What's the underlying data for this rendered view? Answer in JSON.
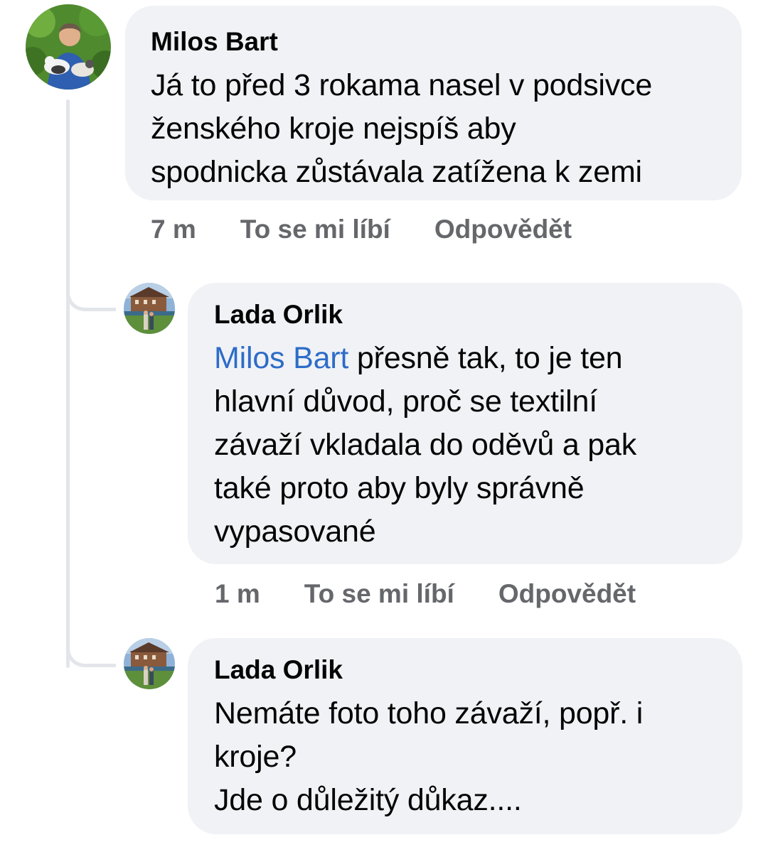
{
  "comments": [
    {
      "author": "Milos Bart",
      "lines": [
        "Já to před 3 rokama nasel v podsivce",
        "ženského kroje nejspíš aby",
        "spodnicka zůstávala zatížena k zemi"
      ],
      "time": "7 m",
      "like_label": "To se mi líbí",
      "reply_label": "Odpovědět"
    },
    {
      "author": "Lada Orlik",
      "mention": "Milos Bart",
      "first_line_rest": " přesně tak, to je ten",
      "lines": [
        "hlavní důvod, proč se textilní",
        "závaží vkladala do oděvů a pak",
        "také proto aby byly správně",
        "vypasované"
      ],
      "time": "1 m",
      "like_label": "To se mi líbí",
      "reply_label": "Odpovědět"
    },
    {
      "author": "Lada Orlik",
      "lines": [
        "Nemáte foto toho závaží, popř. i",
        "kroje?",
        "Jde o důležitý důkaz...."
      ]
    }
  ],
  "colors": {
    "bubble": "#f0f2f5",
    "mention": "#2d6cc8",
    "meta": "#65676b",
    "thread_line": "#e2e5ea"
  },
  "icons": {
    "avatar_main": "avatar-man-with-cats",
    "avatar_reply": "avatar-castle-landscape"
  }
}
